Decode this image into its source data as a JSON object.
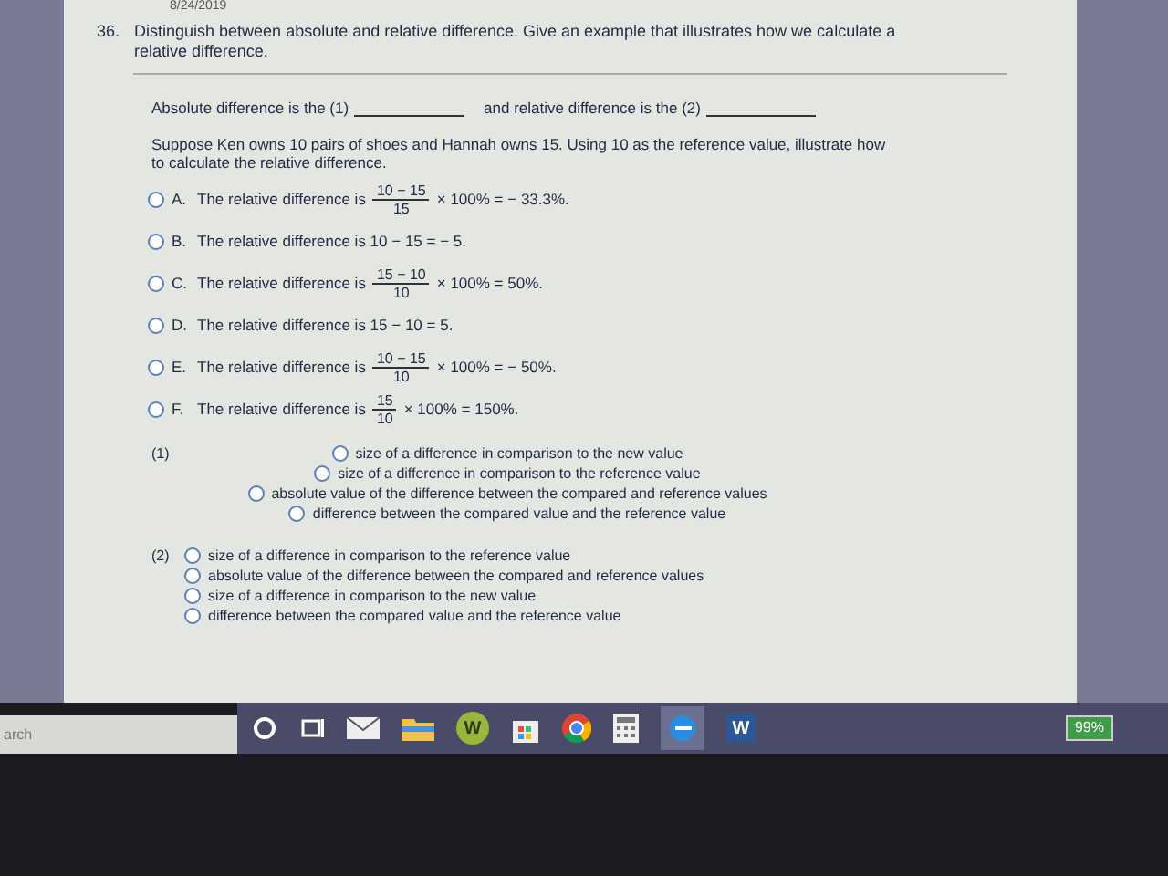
{
  "header": {
    "date": "8/24/2019"
  },
  "question": {
    "number": "36.",
    "text": "Distinguish between absolute and relative difference. Give an example that illustrates how we calculate a relative difference."
  },
  "fill_in": {
    "part1": "Absolute difference is the (1)",
    "part2": "and relative difference is the (2)"
  },
  "scenario": "Suppose Ken owns 10 pairs of shoes and Hannah owns 15. Using 10 as the reference value, illustrate how to calculate the relative difference.",
  "choices": [
    {
      "letter": "A.",
      "kind": "fraction",
      "text": "The relative difference is",
      "numerator": "10 − 15",
      "denominator": "15",
      "after": "× 100% = − 33.3%.",
      "selected": false
    },
    {
      "letter": "B.",
      "kind": "plain",
      "text": "The relative difference is 10 − 15 = − 5.",
      "selected": false
    },
    {
      "letter": "C.",
      "kind": "fraction",
      "text": "The relative difference is",
      "numerator": "15 − 10",
      "denominator": "10",
      "after": "× 100% = 50%.",
      "selected": false
    },
    {
      "letter": "D.",
      "kind": "plain",
      "text": "The relative difference is 15 − 10 = 5.",
      "selected": false
    },
    {
      "letter": "E.",
      "kind": "fraction",
      "text": "The relative difference is",
      "numerator": "10 − 15",
      "denominator": "10",
      "after": "× 100% = − 50%.",
      "selected": false
    },
    {
      "letter": "F.",
      "kind": "fraction",
      "text": "The relative difference is",
      "numerator": "15",
      "denominator": "10",
      "after": "× 100% = 150%.",
      "selected": false
    }
  ],
  "blank_1": {
    "label": "(1)",
    "options": [
      {
        "text": "size of a difference in comparison to the new value",
        "selected": false
      },
      {
        "text": "size of a difference in comparison to the reference value",
        "selected": false
      },
      {
        "text": "absolute value of the difference between the compared and reference values",
        "selected": false
      },
      {
        "text": "difference between the compared value and the reference value",
        "selected": false
      }
    ]
  },
  "blank_2": {
    "label": "(2)",
    "options": [
      {
        "text": "size of a difference in comparison to the reference value",
        "selected": false
      },
      {
        "text": "absolute value of the difference between the compared and reference values",
        "selected": false
      },
      {
        "text": "size of a difference in comparison to the new value",
        "selected": false
      },
      {
        "text": "difference between the compared value and the reference value",
        "selected": false
      }
    ]
  },
  "taskbar": {
    "search": "arch",
    "apps": [
      {
        "kind": "cortana"
      },
      {
        "kind": "taskview"
      },
      {
        "kind": "mail"
      },
      {
        "kind": "folder"
      },
      {
        "kind": "wcircle",
        "label": "W"
      },
      {
        "kind": "store"
      },
      {
        "kind": "chrome"
      },
      {
        "kind": "calculator"
      },
      {
        "kind": "edge"
      },
      {
        "kind": "word",
        "label": "W"
      }
    ],
    "battery": "99%"
  }
}
